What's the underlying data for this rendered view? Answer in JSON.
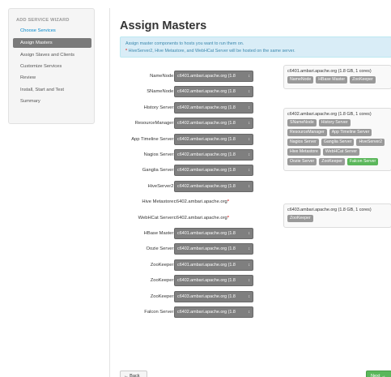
{
  "sidebar": {
    "title": "ADD SERVICE WIZARD",
    "items": [
      {
        "label": "Choose Services"
      },
      {
        "label": "Assign Masters"
      },
      {
        "label": "Assign Slaves and Clients"
      },
      {
        "label": "Customize Services"
      },
      {
        "label": "Review"
      },
      {
        "label": "Install, Start and Test"
      },
      {
        "label": "Summary"
      }
    ]
  },
  "main": {
    "title": "Assign Masters",
    "info_line1": "Assign master components to hosts you want to run them on.",
    "info_star": "*",
    "info_line2": "HiveServer2, Hive Metastore, and WebHCat Server will be hosted on the same server."
  },
  "assignments": [
    {
      "label": "NameNode:",
      "value": "c6401.ambari.apache.org (1.8"
    },
    {
      "label": "SNameNode:",
      "value": "c6402.ambari.apache.org (1.8"
    },
    {
      "label": "History Server:",
      "value": "c6402.ambari.apache.org (1.8"
    },
    {
      "label": "ResourceManager:",
      "value": "c6402.ambari.apache.org (1.8"
    },
    {
      "label": "App Timeline Server:",
      "value": "c6402.ambari.apache.org (1.8"
    },
    {
      "label": "Nagios Server:",
      "value": "c6402.ambari.apache.org (1.8"
    },
    {
      "label": "Ganglia Server:",
      "value": "c6402.ambari.apache.org (1.8"
    },
    {
      "label": "HiveServer2:",
      "value": "c6402.ambari.apache.org (1.8"
    },
    {
      "label": "Hive Metastore:",
      "value": "c6402.ambari.apache.org",
      "star": "*"
    },
    {
      "label": "WebHCat Server:",
      "value": "c6402.ambari.apache.org",
      "star": "*"
    },
    {
      "label": "HBase Master:",
      "value": "c6401.ambari.apache.org (1.8"
    },
    {
      "label": "Oozie Server:",
      "value": "c6402.ambari.apache.org (1.8"
    },
    {
      "label": "ZooKeeper:",
      "value": "c6401.ambari.apache.org (1.8"
    },
    {
      "label": "ZooKeeper:",
      "value": "c6402.ambari.apache.org (1.8"
    },
    {
      "label": "ZooKeeper:",
      "value": "c6403.ambari.apache.org (1.8"
    },
    {
      "label": "Falcon Server:",
      "value": "c6402.ambari.apache.org (1.8"
    }
  ],
  "hosts": [
    {
      "title": "c6401.ambari.apache.org (1.8 GB, 1 cores)",
      "components": [
        "NameNode",
        "HBase Master",
        "ZooKeeper"
      ]
    },
    {
      "title": "c6402.ambari.apache.org (1.8 GB, 1 cores)",
      "components": [
        "SNameNode",
        "History Server",
        "ResourceManager",
        "App Timeline Server",
        "Nagios Server",
        "Ganglia Server",
        "HiveServer2",
        "Hive Metastore",
        "WebHCat Server",
        "Oozie Server",
        "ZooKeeper",
        "Falcon Server"
      ],
      "highlight": "Falcon Server"
    },
    {
      "title": "c6403.ambari.apache.org (1.8 GB, 1 cores)",
      "components": [
        "ZooKeeper"
      ]
    }
  ],
  "footer": {
    "back_label": "← Back",
    "next_label": "Next →"
  },
  "colors": {
    "link": "#0088cc",
    "active_nav": "#7a7a7a",
    "info_bg": "#d9edf7",
    "badge_new": "#5bb75b",
    "next_button": "#5bb75b"
  },
  "icons": {
    "select_arrows": "updown-arrows-icon"
  }
}
